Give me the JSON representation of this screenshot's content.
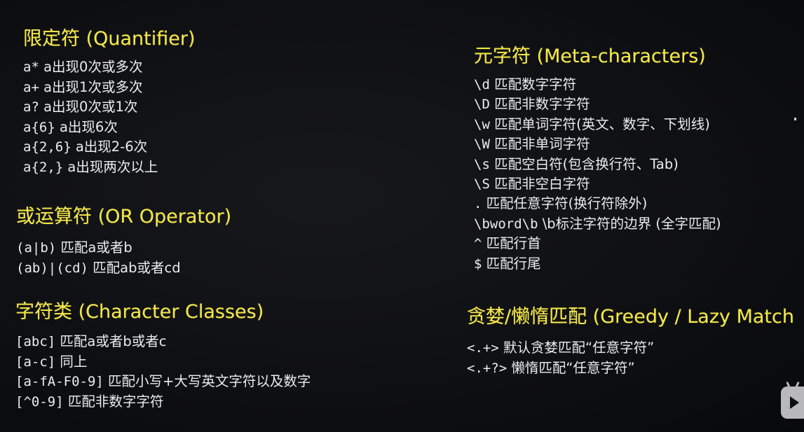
{
  "quantifier": {
    "title": "限定符 (Quantifier)",
    "lines": [
      {
        "code": "a*",
        "desc": " a出现0次或多次"
      },
      {
        "code": "a+",
        "desc": " a出现1次或多次"
      },
      {
        "code": "a?",
        "desc": " a出现0次或1次"
      },
      {
        "code": "a{6}",
        "desc": " a出现6次"
      },
      {
        "code": "a{2,6}",
        "desc": " a出现2-6次"
      },
      {
        "code": "a{2,}",
        "desc": " a出现两次以上"
      }
    ]
  },
  "or_operator": {
    "title": "或运算符 (OR Operator)",
    "lines": [
      {
        "code": "(a|b)",
        "desc": " 匹配a或者b"
      },
      {
        "code": "(ab)|(cd)",
        "desc": " 匹配ab或者cd"
      }
    ]
  },
  "character_classes": {
    "title": "字符类 (Character Classes)",
    "lines": [
      {
        "code": "[abc]",
        "desc": " 匹配a或者b或者c"
      },
      {
        "code": "[a-c]",
        "desc": " 同上"
      },
      {
        "code": "[a-fA-F0-9]",
        "desc": " 匹配小写+大写英文字符以及数字"
      },
      {
        "code": "[^0-9]",
        "desc": " 匹配非数字字符"
      }
    ]
  },
  "meta_characters": {
    "title": "元字符 (Meta-characters)",
    "lines": [
      {
        "code": "\\d",
        "desc": " 匹配数字字符"
      },
      {
        "code": "\\D",
        "desc": " 匹配非数字字符"
      },
      {
        "code": "\\w",
        "desc": " 匹配单词字符(英文、数字、下划线)"
      },
      {
        "code": "\\W",
        "desc": " 匹配非单词字符"
      },
      {
        "code": "\\s",
        "desc": " 匹配空白符(包含换行符、Tab)"
      },
      {
        "code": "\\S",
        "desc": " 匹配非空白字符"
      },
      {
        "code": ".",
        "desc": " 匹配任意字符(换行符除外)"
      },
      {
        "code": "\\bword\\b",
        "desc": " \\b标注字符的边界 (全字匹配)"
      },
      {
        "code": "^",
        "desc": " 匹配行首"
      },
      {
        "code": "$",
        "desc": " 匹配行尾"
      }
    ]
  },
  "greedy_lazy": {
    "title": "贪婪/懒惰匹配 (Greedy / Lazy Match",
    "lines": [
      {
        "code": "<.+>",
        "desc": " 默认贪婪匹配“任意字符”"
      },
      {
        "code": "<.+?>",
        "desc": " 懒惰匹配“任意字符”"
      }
    ]
  },
  "colors": {
    "heading": "#f4e84a",
    "text": "#ececee",
    "background": "#0f1013"
  },
  "icons": {
    "corner": "bilibili-tv-icon"
  }
}
